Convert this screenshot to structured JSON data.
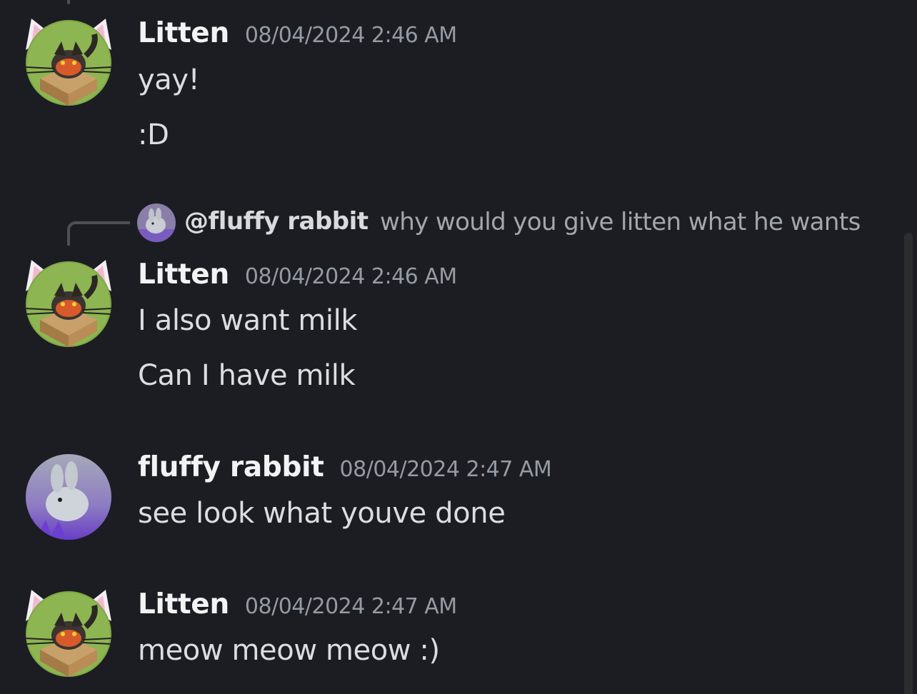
{
  "messages": [
    {
      "author": "Litten",
      "timestamp": "08/04/2024 2:46 AM",
      "lines": [
        "yay!",
        ":D"
      ]
    },
    {
      "reply": {
        "author": "@fluffy rabbit",
        "preview": "why would you give litten what he wants"
      },
      "author": "Litten",
      "timestamp": "08/04/2024 2:46 AM",
      "lines": [
        "I also want milk",
        "Can I have milk"
      ]
    },
    {
      "author": "fluffy rabbit",
      "timestamp": "08/04/2024 2:47 AM",
      "lines": [
        "see look what youve done"
      ]
    },
    {
      "author": "Litten",
      "timestamp": "08/04/2024 2:47 AM",
      "lines": [
        "meow meow meow :)"
      ]
    }
  ],
  "colors": {
    "background": "#1c1d22",
    "username": "#f2f3f5",
    "timestamp": "#949ba4",
    "text": "#dbdee1",
    "reply_line": "#4e5058"
  },
  "icons": {
    "litten_avatar": "litten-cat-avatar-icon",
    "rabbit_avatar": "fluffy-rabbit-avatar-icon"
  }
}
